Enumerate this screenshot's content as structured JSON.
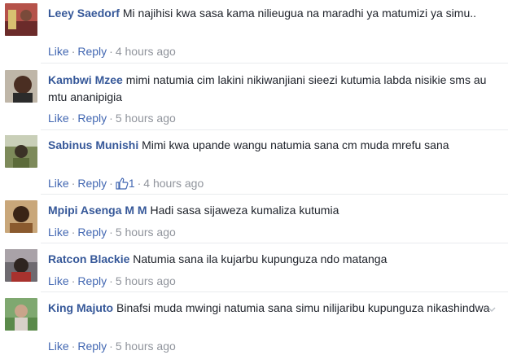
{
  "comments": [
    {
      "author": "Leey Saedorf",
      "text": "Mi najihisi kwa sasa kama nilieugua na maradhi ya matumizi ya simu..",
      "like_label": "Like",
      "reply_label": "Reply",
      "time": "4 hours ago"
    },
    {
      "author": "Kambwi Mzee",
      "text": "mimi natumia cim lakini nikiwanjiani sieezi kutumia labda nisikie sms au mtu ananipigia",
      "like_label": "Like",
      "reply_label": "Reply",
      "time": "5 hours ago"
    },
    {
      "author": "Sabinus Munishi",
      "text": "Mimi kwa upande wangu natumia sana cm muda mrefu sana",
      "like_label": "Like",
      "reply_label": "Reply",
      "like_count": "1",
      "time": "4 hours ago"
    },
    {
      "author": "Mpipi Asenga M M",
      "text": "Hadi sasa sijaweza kumaliza kutumia",
      "like_label": "Like",
      "reply_label": "Reply",
      "time": "5 hours ago"
    },
    {
      "author": "Ratcon Blackie",
      "text": "Natumia sana ila kujarbu kupunguza ndo matanga",
      "like_label": "Like",
      "reply_label": "Reply",
      "time": "5 hours ago"
    },
    {
      "author": "King Majuto",
      "text": "Binafsi muda mwingi natumia sana simu nilijaribu kupunguza nikashindwa",
      "like_label": "Like",
      "reply_label": "Reply",
      "time": "5 hours ago"
    }
  ],
  "separator": "·",
  "colors": {
    "author": "#365899",
    "link": "#4267b2",
    "meta": "#90949c"
  }
}
